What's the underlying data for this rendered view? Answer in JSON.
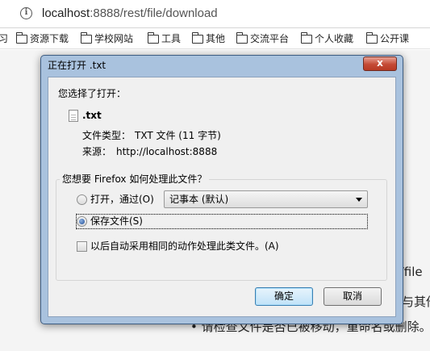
{
  "browser": {
    "url_host": "localhost",
    "url_rest": ":8888/rest/file/download",
    "bookmarks": [
      "习",
      "资源下载",
      "学校网站",
      "工具",
      "其他",
      "交流平台",
      "个人收藏",
      "公开课"
    ]
  },
  "page_background": {
    "fragments": [
      "st/file",
      "与其他",
      "• 请检查文件是否已被移动，重命名或删除。"
    ]
  },
  "dialog": {
    "title": "正在打开 .txt",
    "close_label": "x",
    "intro": "您选择了打开：",
    "file_name": ".txt",
    "file_type_label": "文件类型：",
    "file_type_value": "TXT 文件 (11 字节)",
    "source_label": "来源：",
    "source_value": "http://localhost:8888",
    "question": "您想要 Firefox 如何处理此文件？",
    "open_with_label": "打开，通过(O)",
    "open_with_selected": "记事本 (默认)",
    "save_file_label": "保存文件(S)",
    "remember_label": "以后自动采用相同的动作处理此类文件。(A)",
    "ok_label": "确定",
    "cancel_label": "取消",
    "save_selected": true,
    "remember_checked": false
  },
  "colors": {
    "dialog_frame": "#a9c2de",
    "close_button": "#c44a35"
  }
}
